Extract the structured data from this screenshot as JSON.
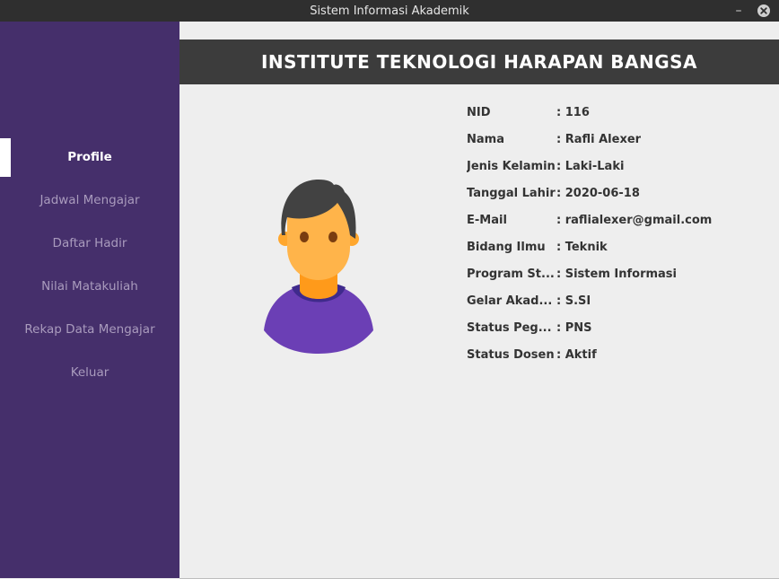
{
  "window": {
    "title": "Sistem Informasi Akademik",
    "minimize_glyph": "–",
    "close_icon": "close-icon"
  },
  "header": {
    "title": "INSTITUTE TEKNOLOGI HARAPAN BANGSA"
  },
  "sidebar": {
    "items": [
      {
        "label": "Profile",
        "active": true
      },
      {
        "label": "Jadwal Mengajar",
        "active": false
      },
      {
        "label": "Daftar Hadir",
        "active": false
      },
      {
        "label": "Nilai Matakuliah",
        "active": false
      },
      {
        "label": "Rekap Data Mengajar",
        "active": false
      },
      {
        "label": "Keluar",
        "active": false
      }
    ]
  },
  "profile": {
    "avatar_icon": "user-avatar-icon",
    "fields": [
      {
        "label": "NID",
        "value": ": 116"
      },
      {
        "label": "Nama",
        "value": ": Rafli Alexer"
      },
      {
        "label": "Jenis Kelamin",
        "value": ": Laki-Laki"
      },
      {
        "label": "Tanggal Lahir",
        "value": ": 2020-06-18"
      },
      {
        "label": "E-Mail",
        "value": ": raflialexer@gmail.com"
      },
      {
        "label": "Bidang Ilmu",
        "value": ": Teknik"
      },
      {
        "label": "Program St...",
        "value": ": Sistem Informasi"
      },
      {
        "label": "Gelar Akad...",
        "value": ": S.SI"
      },
      {
        "label": "Status Peg...",
        "value": ": PNS"
      },
      {
        "label": "Status Dosen",
        "value": ": Aktif"
      }
    ]
  },
  "colors": {
    "sidebar": "#452f6b",
    "header": "#3c3c3c",
    "content_bg": "#eeeeee",
    "avatar_shirt": "#6b3fb5",
    "avatar_skin": "#ffb44a"
  }
}
